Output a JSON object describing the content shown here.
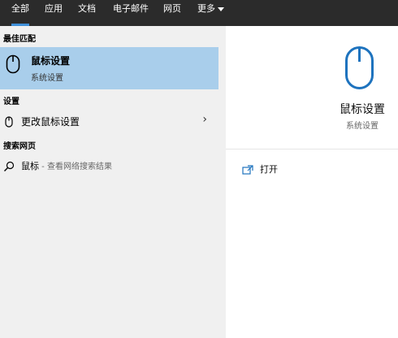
{
  "tabs": [
    "全部",
    "应用",
    "文档",
    "电子邮件",
    "网页",
    "更多"
  ],
  "left": {
    "best_match_header": "最佳匹配",
    "best_match": {
      "title": "鼠标设置",
      "subtitle": "系统设置"
    },
    "settings_header": "设置",
    "settings_item": "更改鼠标设置",
    "web_header": "搜索网页",
    "web_item": {
      "query": "鼠标",
      "hint": " - 查看网络搜索结果"
    }
  },
  "right": {
    "title": "鼠标设置",
    "subtitle": "系统设置",
    "action_open": "打开"
  },
  "colors": {
    "topbar": "#2b2b2b",
    "selected": "#a9ceeb",
    "accent": "#1e73be"
  },
  "icons": [
    "mouse-icon",
    "chevron-right-icon",
    "search-icon",
    "open-icon",
    "chevron-down-icon"
  ]
}
